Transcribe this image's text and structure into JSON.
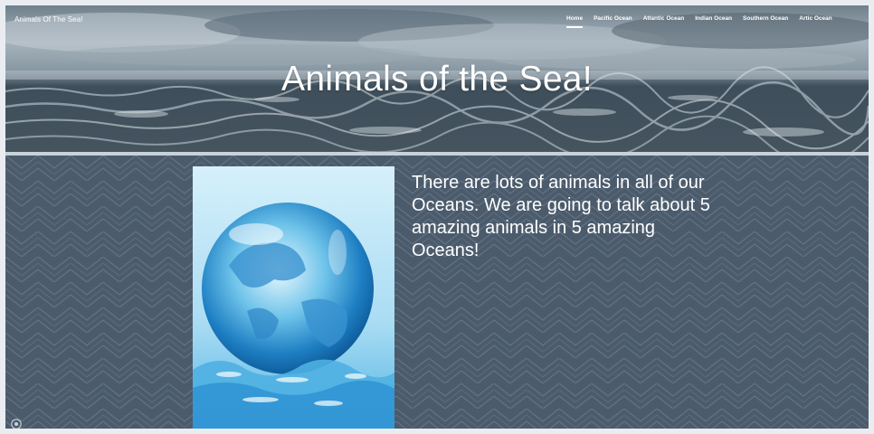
{
  "header": {
    "site_title": "Animals Of The Sea!",
    "nav": [
      {
        "label": "Home",
        "active": true
      },
      {
        "label": "Pacific Ocean",
        "active": false
      },
      {
        "label": "Atlantic Ocean",
        "active": false
      },
      {
        "label": "Indian Ocean",
        "active": false
      },
      {
        "label": "Southern Ocean",
        "active": false
      },
      {
        "label": "Artic Ocean",
        "active": false
      }
    ]
  },
  "hero": {
    "title": "Animals of the Sea!"
  },
  "main": {
    "intro_text": "There are lots of animals in all of our Oceans. We are going to talk about 5 amazing animals in 5 amazing Oceans!",
    "image_icon": "globe-image"
  },
  "footer": {
    "icon": "settings-icon"
  },
  "colors": {
    "content_bg": "#4b5b6c",
    "pattern": "#6d7e8e",
    "text": "#ffffff"
  }
}
